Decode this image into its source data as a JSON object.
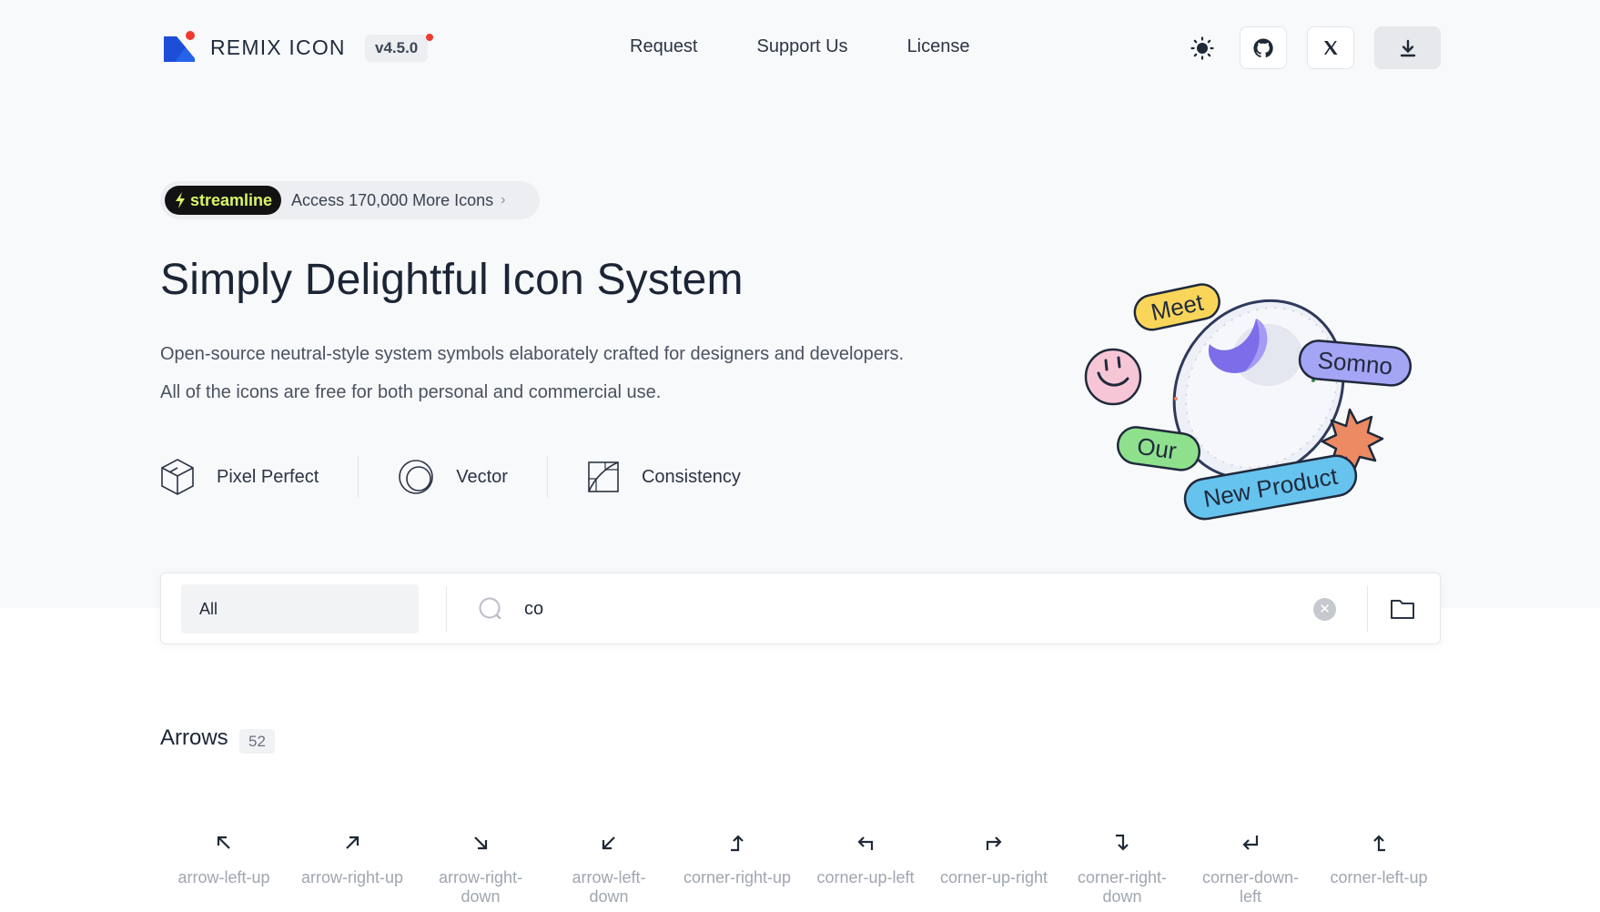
{
  "header": {
    "logo_text": "REMIX ICON",
    "version": "v4.5.0",
    "nav": [
      "Request",
      "Support Us",
      "License"
    ],
    "buttons": [
      "theme-toggle",
      "github",
      "x",
      "download"
    ]
  },
  "promo": {
    "badge": "streamline",
    "text": "Access 170,000 More Icons"
  },
  "hero": {
    "title": "Simply Delightful Icon System",
    "desc_line1": "Open-source neutral-style system symbols elaborately crafted for designers and developers.",
    "desc_line2": "All of the icons are free for both personal and commercial use.",
    "features": [
      "Pixel Perfect",
      "Vector",
      "Consistency"
    ]
  },
  "illustration": {
    "labels": [
      "Meet",
      "Somno",
      "Our",
      "New Product"
    ]
  },
  "search": {
    "category": "All",
    "query": "co"
  },
  "section": {
    "title": "Arrows",
    "count": "52",
    "icons": [
      {
        "name": "arrow-left-up",
        "icon": "arrow-left-up-icon"
      },
      {
        "name": "arrow-right-up",
        "icon": "arrow-right-up-icon"
      },
      {
        "name": "arrow-right-down",
        "icon": "arrow-right-down-icon"
      },
      {
        "name": "arrow-left-down",
        "icon": "arrow-left-down-icon"
      },
      {
        "name": "corner-right-up",
        "icon": "corner-right-up-icon"
      },
      {
        "name": "corner-up-left",
        "icon": "corner-up-left-icon"
      },
      {
        "name": "corner-up-right",
        "icon": "corner-up-right-icon"
      },
      {
        "name": "corner-right-down",
        "icon": "corner-right-down-icon"
      },
      {
        "name": "corner-down-left",
        "icon": "corner-down-left-icon"
      },
      {
        "name": "corner-left-up",
        "icon": "corner-left-up-icon"
      }
    ]
  },
  "colors": {
    "logo_blue": "#2563eb",
    "logo_dot": "#ef3b2d",
    "streamline_badge": "#121212",
    "streamline_text": "#d9f56a",
    "meet_yellow": "#f9d65a",
    "somno_purple": "#a5a5f5",
    "our_green": "#8fe08d",
    "newproduct_blue": "#66c3ee",
    "star_orange": "#ec8a63",
    "smiley_pink": "#f7c6d6"
  }
}
